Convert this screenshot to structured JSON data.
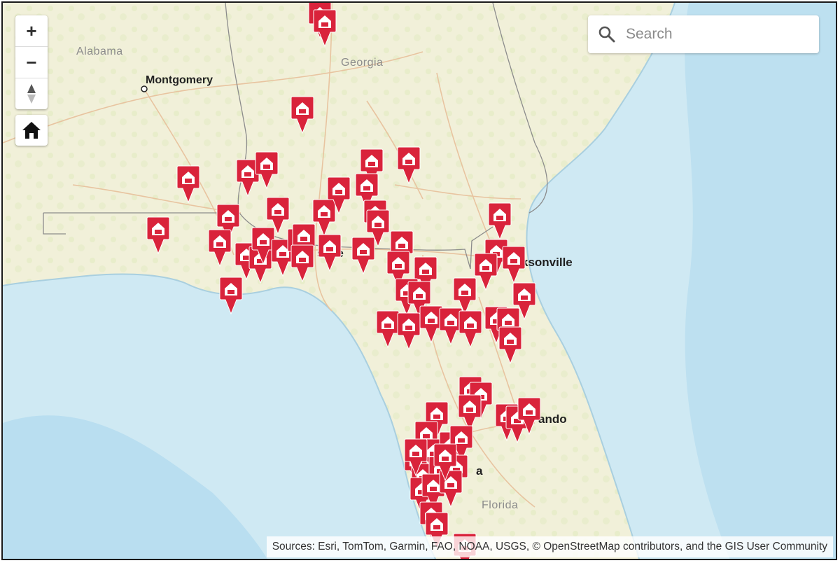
{
  "map": {
    "colors": {
      "land": "#f1f0d9",
      "land_texture": "#e9ecc9",
      "water": "#cfe9f3",
      "water_deep": "#b6dcef",
      "border": "#8c8c8c",
      "road": "#e8c4a0",
      "marker": "#d9233b"
    },
    "labels": {
      "alabama": "Alabama",
      "georgia": "Georgia",
      "florida": "Florida",
      "montgomery": "Montgomery",
      "tallahassee_partial": "ssee",
      "jacksonville_partial": "ksonville",
      "orlando_partial": "ando",
      "tampa_partial": "a"
    },
    "marker_icon": "shelter-house-icon"
  },
  "controls": {
    "zoom_in_label": "+",
    "zoom_out_label": "−",
    "compass_icon": "compass-icon",
    "home_icon": "home-icon"
  },
  "search": {
    "placeholder": "Search",
    "value": ""
  },
  "attribution": {
    "text": "Sources: Esri, TomTom, Garmin, FAO, NOAA, USGS, © OpenStreetMap contributors, and the GIS User Community"
  }
}
